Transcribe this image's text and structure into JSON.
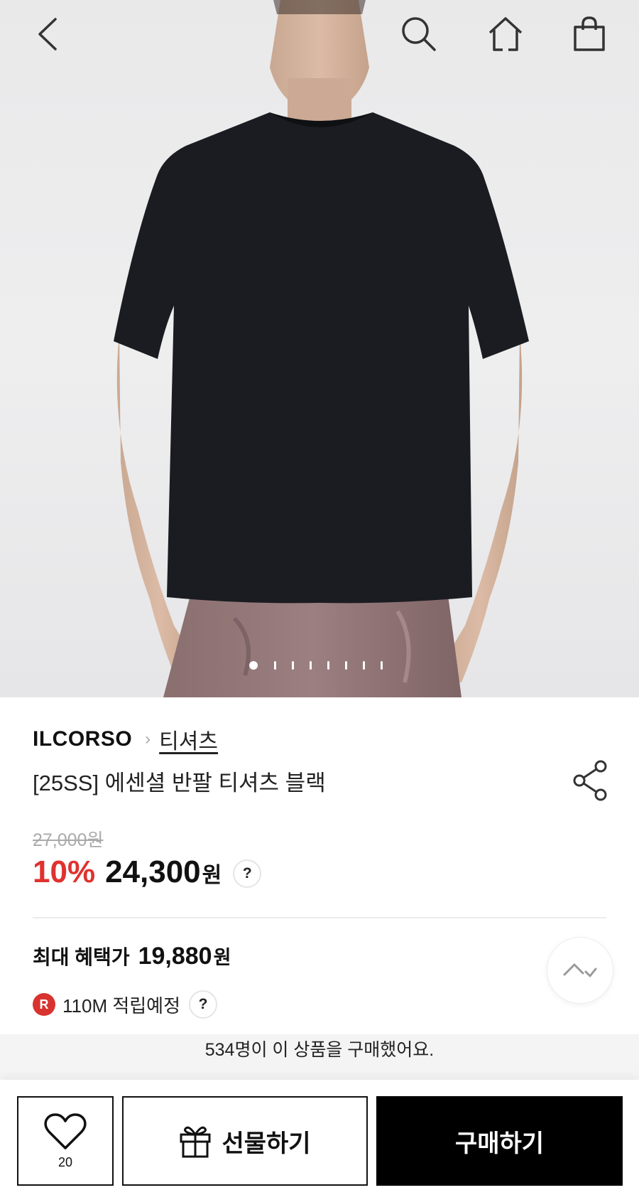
{
  "product": {
    "brand": "ILCORSO",
    "category": "티셔츠",
    "title": "[25SS] 에센셜 반팔 티셔츠 블랙",
    "original_price": "27,000원",
    "discount": "10%",
    "price": "24,300",
    "price_unit": "원",
    "help_mark": "?"
  },
  "benefit": {
    "label": "최대 혜택가",
    "price": "19,880",
    "unit": "원"
  },
  "points": {
    "badge": "R",
    "text": "110M 적립예정",
    "help_mark": "?"
  },
  "buyers_text": "534명이 이 상품을 구매했어요.",
  "carousel": {
    "total": 8,
    "active_index": 0
  },
  "bottom_bar": {
    "like_count": "20",
    "gift_label": "선물하기",
    "buy_label": "구매하기"
  },
  "colors": {
    "sale_red": "#e0322f",
    "badge_red": "#d8332f",
    "button_black": "#000000"
  },
  "icons": [
    "back-icon",
    "search-icon",
    "home-icon",
    "cart-icon",
    "share-icon",
    "heart-icon",
    "gift-icon",
    "scroll-top-icon"
  ]
}
